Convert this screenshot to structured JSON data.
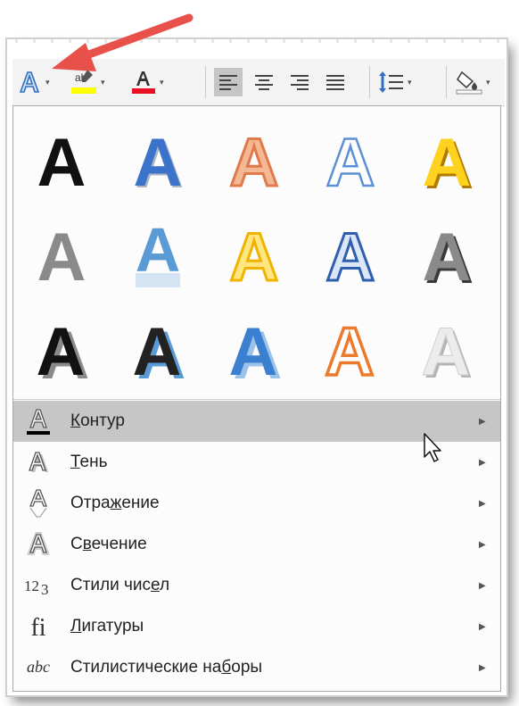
{
  "toolbar": {
    "text_effects_icon": "text-effects-icon",
    "highlight_color": "#ffff00",
    "font_color": "#e81123",
    "buttons": [
      "text-effects",
      "highlight",
      "font-color",
      "align-left",
      "align-center",
      "align-right",
      "justify",
      "line-spacing",
      "shading"
    ]
  },
  "gallery": {
    "rows": 3,
    "columns": 5
  },
  "menu": {
    "items": [
      {
        "label_before": "",
        "label_access": "К",
        "label_after": "онтур",
        "icon": "outline-icon",
        "has_submenu": true,
        "highlighted": true
      },
      {
        "label_before": "",
        "label_access": "Т",
        "label_after": "ень",
        "icon": "shadow-icon",
        "has_submenu": true,
        "highlighted": false
      },
      {
        "label_before": "Отра",
        "label_access": "ж",
        "label_after": "ение",
        "icon": "reflection-icon",
        "has_submenu": true,
        "highlighted": false
      },
      {
        "label_before": "С",
        "label_access": "в",
        "label_after": "ечение",
        "icon": "glow-icon",
        "has_submenu": true,
        "highlighted": false
      },
      {
        "label_before": "Стили чис",
        "label_access": "е",
        "label_after": "л",
        "icon": "number-styles-icon",
        "icon_text": "123",
        "has_submenu": true,
        "highlighted": false
      },
      {
        "label_before": "",
        "label_access": "Л",
        "label_after": "игатуры",
        "icon": "ligatures-icon",
        "icon_text": "fi",
        "has_submenu": true,
        "highlighted": false
      },
      {
        "label_before": "Стилистические на",
        "label_access": "б",
        "label_after": "оры",
        "icon": "stylistic-sets-icon",
        "icon_text": "abc",
        "has_submenu": true,
        "highlighted": false
      }
    ]
  },
  "colors": {
    "outline_bar": "#000000",
    "callout_arrow": "#e8514a"
  }
}
